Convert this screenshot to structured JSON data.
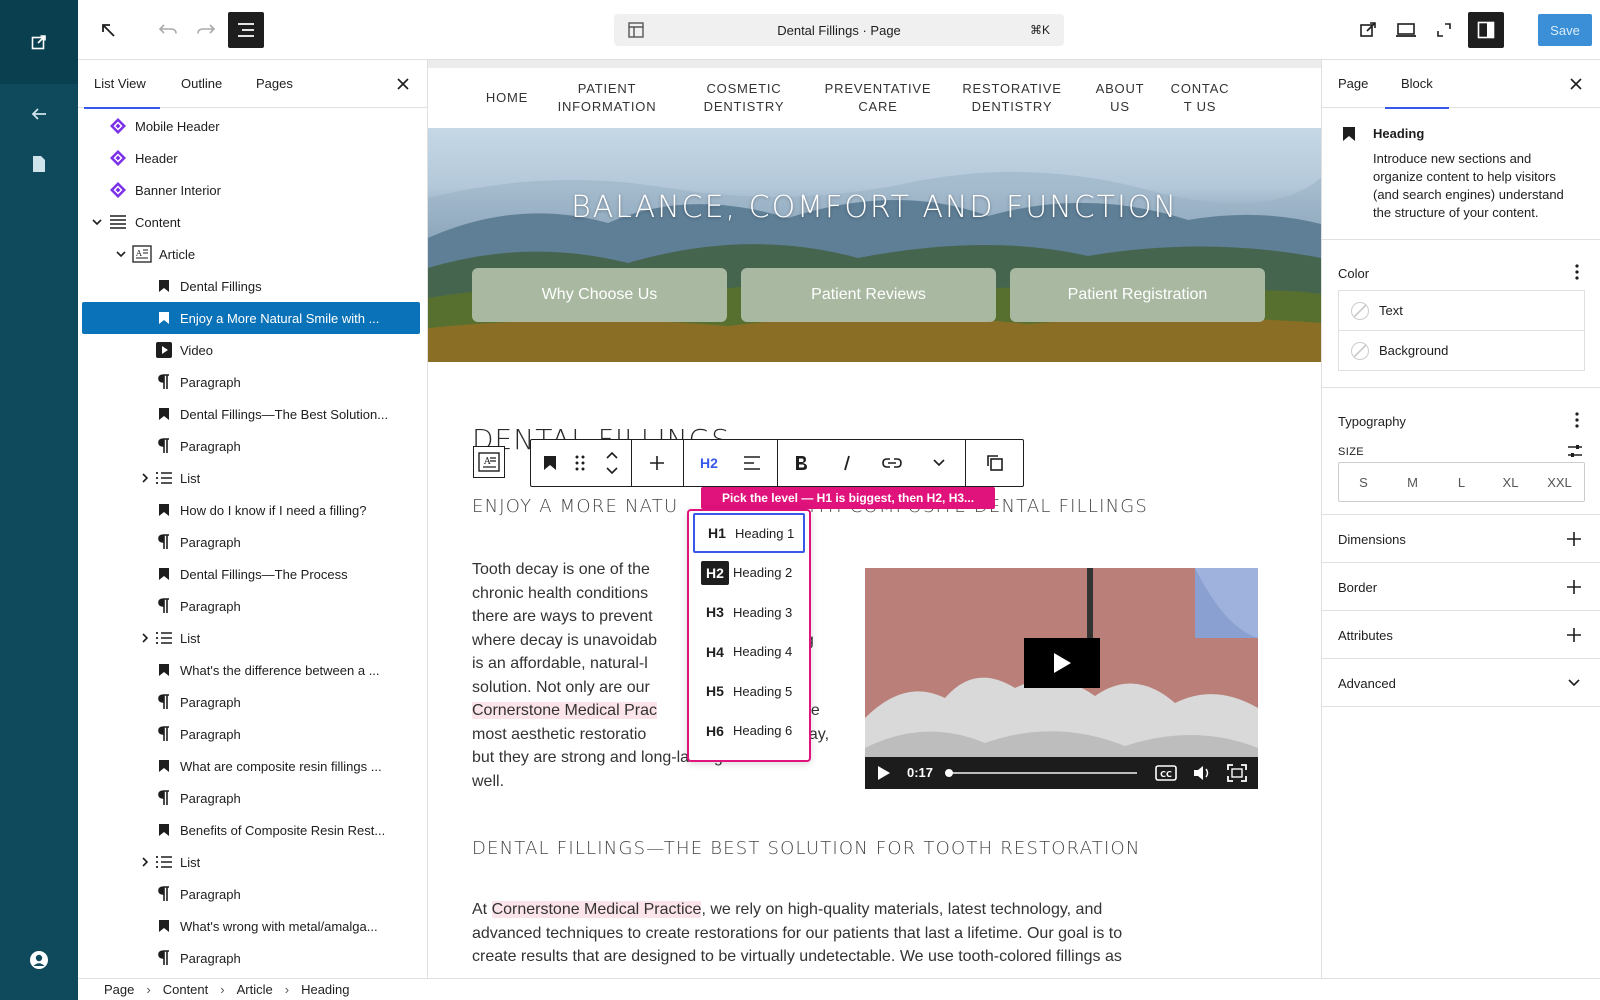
{
  "window": {
    "doc_title": "Dental Fillings · Page",
    "shortcut": "⌘K",
    "save_label": "Save"
  },
  "list_view": {
    "tabs": [
      "List View",
      "Outline",
      "Pages"
    ],
    "items": [
      {
        "label": "Mobile Header",
        "icon": "pattern-icon",
        "depth": 0,
        "expander": "none"
      },
      {
        "label": "Header",
        "icon": "pattern-icon",
        "depth": 0,
        "expander": "none"
      },
      {
        "label": "Banner Interior",
        "icon": "pattern-icon",
        "depth": 0,
        "expander": "none"
      },
      {
        "label": "Content",
        "icon": "content-icon",
        "depth": 0,
        "expander": "open"
      },
      {
        "label": "Article",
        "icon": "article-icon",
        "depth": 1,
        "expander": "open"
      },
      {
        "label": "Dental Fillings",
        "icon": "heading-icon",
        "depth": 2,
        "expander": "none"
      },
      {
        "label": "Enjoy a More Natural Smile with ...",
        "icon": "heading-icon",
        "depth": 2,
        "expander": "none",
        "selected": true
      },
      {
        "label": "Video",
        "icon": "video-icon",
        "depth": 2,
        "expander": "none"
      },
      {
        "label": "Paragraph",
        "icon": "paragraph-icon",
        "depth": 2,
        "expander": "none"
      },
      {
        "label": "Dental Fillings—The Best Solution...",
        "icon": "heading-icon",
        "depth": 2,
        "expander": "none"
      },
      {
        "label": "Paragraph",
        "icon": "paragraph-icon",
        "depth": 2,
        "expander": "none"
      },
      {
        "label": "List",
        "icon": "list-icon",
        "depth": 2,
        "expander": "closed"
      },
      {
        "label": "How do I know if I need a filling?",
        "icon": "heading-icon",
        "depth": 2,
        "expander": "none"
      },
      {
        "label": "Paragraph",
        "icon": "paragraph-icon",
        "depth": 2,
        "expander": "none"
      },
      {
        "label": "Dental Fillings—The Process",
        "icon": "heading-icon",
        "depth": 2,
        "expander": "none"
      },
      {
        "label": "Paragraph",
        "icon": "paragraph-icon",
        "depth": 2,
        "expander": "none"
      },
      {
        "label": "List",
        "icon": "list-icon",
        "depth": 2,
        "expander": "closed"
      },
      {
        "label": "What's the difference between a ...",
        "icon": "heading-icon",
        "depth": 2,
        "expander": "none"
      },
      {
        "label": "Paragraph",
        "icon": "paragraph-icon",
        "depth": 2,
        "expander": "none"
      },
      {
        "label": "Paragraph",
        "icon": "paragraph-icon",
        "depth": 2,
        "expander": "none"
      },
      {
        "label": "What are composite resin fillings ...",
        "icon": "heading-icon",
        "depth": 2,
        "expander": "none"
      },
      {
        "label": "Paragraph",
        "icon": "paragraph-icon",
        "depth": 2,
        "expander": "none"
      },
      {
        "label": "Benefits of Composite Resin Rest...",
        "icon": "heading-icon",
        "depth": 2,
        "expander": "none"
      },
      {
        "label": "List",
        "icon": "list-icon",
        "depth": 2,
        "expander": "closed"
      },
      {
        "label": "Paragraph",
        "icon": "paragraph-icon",
        "depth": 2,
        "expander": "none"
      },
      {
        "label": "What's wrong with metal/amalga...",
        "icon": "heading-icon",
        "depth": 2,
        "expander": "none"
      },
      {
        "label": "Paragraph",
        "icon": "paragraph-icon",
        "depth": 2,
        "expander": "none"
      }
    ]
  },
  "breadcrumb": [
    "Page",
    "Content",
    "Article",
    "Heading"
  ],
  "site": {
    "nav": [
      {
        "line1": "HOME",
        "line2": ""
      },
      {
        "line1": "PATIENT",
        "line2": "INFORMATION"
      },
      {
        "line1": "COSMETIC",
        "line2": "DENTISTRY"
      },
      {
        "line1": "PREVENTATIVE",
        "line2": "CARE"
      },
      {
        "line1": "RESTORATIVE",
        "line2": "DENTISTRY"
      },
      {
        "line1": "ABOUT",
        "line2": "US"
      },
      {
        "line1": "CONTAC",
        "line2": "T US"
      }
    ],
    "hero_title": "BALANCE, COMFORT AND FUNCTION",
    "hero_buttons": [
      "Why Choose Us",
      "Patient Reviews",
      "Patient Registration"
    ],
    "page_heading": "DENTAL FILLINGS",
    "subheading_left": "ENJOY A MORE NATU",
    "subheading_right": "WITH COMPOSITE DENTAL FILLINGS",
    "body_lines": [
      "Tooth decay is one of the",
      "chronic health conditions",
      "there are ways to prevent",
      "where decay is unavoidab",
      "is an affordable, natural-l",
      "solution. Not only are our",
      "Cornerstone Medical Prac",
      "most aesthetic restoratio",
      "but they are strong and long-lasting as",
      "well."
    ],
    "body_right_fragments": [
      "s",
      "ng",
      "e",
      "ne",
      "day,"
    ],
    "video_time": "0:17",
    "heading_best": "DENTAL FILLINGS—THE BEST SOLUTION FOR TOOTH RESTORATION",
    "para2_prefix": "At ",
    "para2_link": "Cornerstone Medical Practice",
    "para2_rest": ", we rely on high-quality materials, latest technology, and",
    "para2_line2": "advanced techniques to create restorations for our patients that last a lifetime. Our goal is to",
    "para2_line3": "create results that are designed to be virtually undetectable. We use tooth-colored fillings as"
  },
  "block_toolbar": {
    "level_label": "H2",
    "tooltip": "Pick the level — H1 is biggest, then H2, H3...",
    "levels": [
      {
        "tag": "H1",
        "label": "Heading 1"
      },
      {
        "tag": "H2",
        "label": "Heading 2"
      },
      {
        "tag": "H3",
        "label": "Heading 3"
      },
      {
        "tag": "H4",
        "label": "Heading 4"
      },
      {
        "tag": "H5",
        "label": "Heading 5"
      },
      {
        "tag": "H6",
        "label": "Heading 6"
      }
    ]
  },
  "sidebar": {
    "tabs": [
      "Page",
      "Block"
    ],
    "block_name": "Heading",
    "block_desc_lines": [
      "Introduce new sections and",
      "organize content to help visitors",
      "(and search engines) understand",
      "the structure of your content."
    ],
    "color_title": "Color",
    "color_items": [
      "Text",
      "Background"
    ],
    "typography_title": "Typography",
    "size_label": "SIZE",
    "sizes": [
      "S",
      "M",
      "L",
      "XL",
      "XXL"
    ],
    "sections": [
      "Dimensions",
      "Border",
      "Attributes",
      "Advanced"
    ]
  },
  "colors": {
    "rail": "#0f4a5c",
    "selected": "#0a72b8",
    "accent": "#3858e9",
    "pink": "#e0127b",
    "save": "#3a8fd6"
  }
}
